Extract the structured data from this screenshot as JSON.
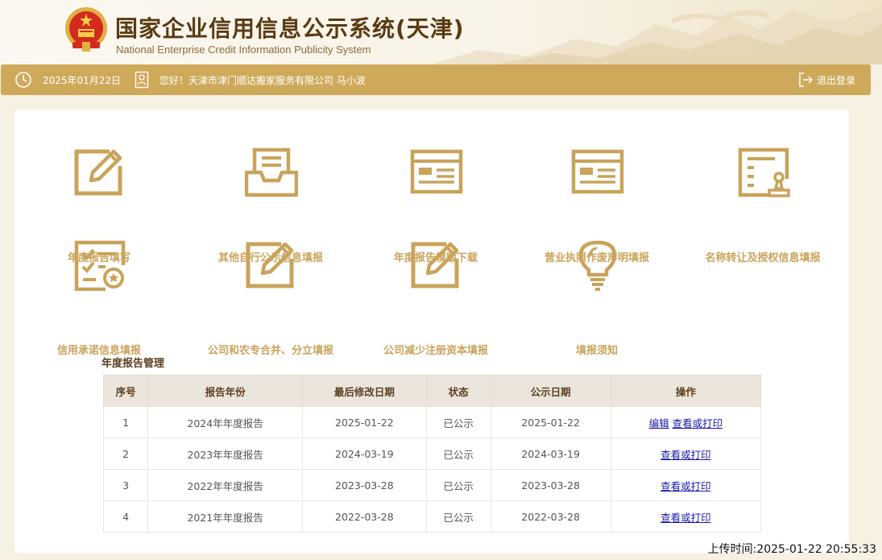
{
  "header": {
    "title_cn": "国家企业信用信息公示系统(天津)",
    "title_en": "National Enterprise Credit Information Publicity System"
  },
  "bar": {
    "date": "2025年01月22日",
    "welcome": "您好！天津市津门顺达搬家服务有限公司  马小波",
    "logout": "退出登录"
  },
  "tiles": [
    {
      "label": "年度报告填写",
      "icon": "edit-icon"
    },
    {
      "label": "其他自行公示信息填报",
      "icon": "inbox-icon"
    },
    {
      "label": "年度报告模版下载",
      "icon": "template-icon"
    },
    {
      "label": "营业执照作废声明填报",
      "icon": "license-icon"
    },
    {
      "label": "名称转让及授权信息填报",
      "icon": "seal-doc-icon"
    },
    {
      "label": "信用承诺信息填报",
      "icon": "checklist-icon"
    },
    {
      "label": "公司和农专合并、分立填报",
      "icon": "edit-icon"
    },
    {
      "label": "公司减少注册资本填报",
      "icon": "edit-icon"
    },
    {
      "label": "填报须知",
      "icon": "lightbulb-icon"
    }
  ],
  "annual_reports": {
    "title": "年度报告管理",
    "columns": [
      "序号",
      "报告年份",
      "最后修改日期",
      "状态",
      "公示日期",
      "操作"
    ],
    "rows": [
      {
        "no": "1",
        "year": "2024年年度报告",
        "modified": "2025-01-22",
        "status": "已公示",
        "published": "2025-01-22",
        "edit": "编辑",
        "view": "查看或打印"
      },
      {
        "no": "2",
        "year": "2023年年度报告",
        "modified": "2024-03-19",
        "status": "已公示",
        "published": "2024-03-19",
        "view": "查看或打印"
      },
      {
        "no": "3",
        "year": "2022年年度报告",
        "modified": "2023-03-28",
        "status": "已公示",
        "published": "2023-03-28",
        "view": "查看或打印"
      },
      {
        "no": "4",
        "year": "2021年年度报告",
        "modified": "2022-03-28",
        "status": "已公示",
        "published": "2022-03-28",
        "view": "查看或打印"
      }
    ]
  },
  "upload_time": "上传时间:2025-01-22 20:55:33",
  "colors": {
    "gold": "#cfa95a",
    "icon": "#c9a35a",
    "brown": "#5a3a12",
    "link": "#1a1aa8"
  }
}
